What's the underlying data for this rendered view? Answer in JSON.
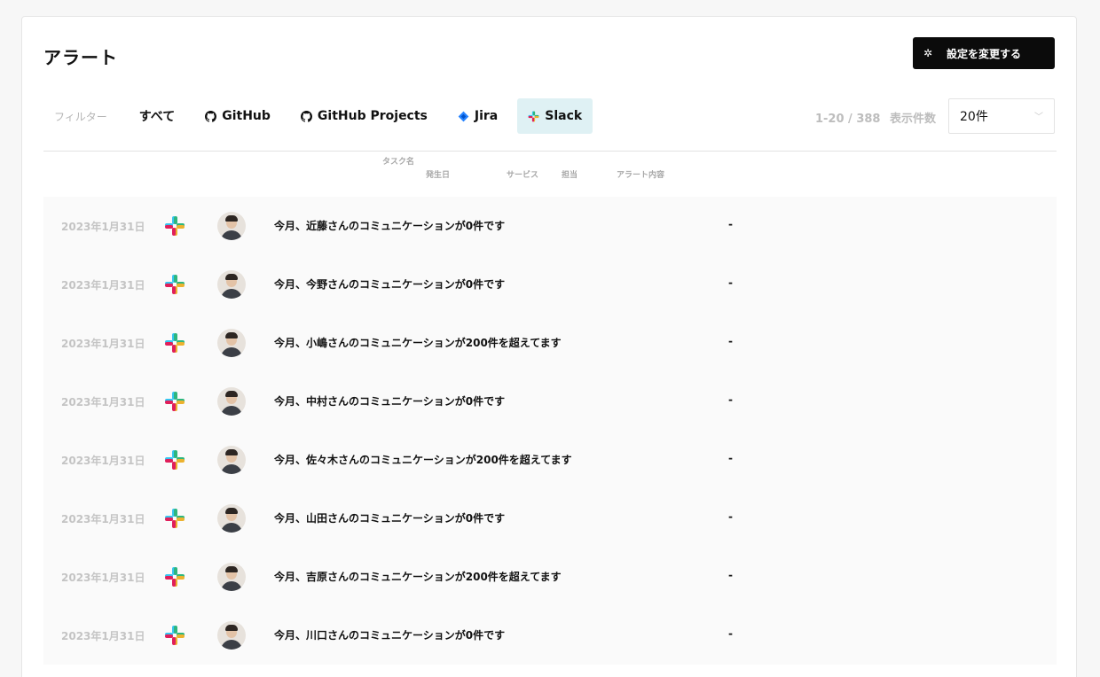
{
  "page": {
    "title": "アラート"
  },
  "toolbar": {
    "settings_label": "設定を変更する",
    "settings_icon": "gear-icon"
  },
  "filters": {
    "label": "フィルター",
    "tabs": [
      {
        "label": "すべて",
        "icon": ""
      },
      {
        "label": "GitHub",
        "icon": "github-icon"
      },
      {
        "label": "GitHub Projects",
        "icon": "github-icon"
      },
      {
        "label": "Jira",
        "icon": "jira-icon"
      },
      {
        "label": "Slack",
        "icon": "slack-icon",
        "active": true
      }
    ]
  },
  "pagination": {
    "range": "1-20 / 388",
    "per_page_label": "表示件数",
    "page_size": "20件"
  },
  "table": {
    "headers": {
      "task": "タスク名",
      "date": "発生日",
      "service": "サービス",
      "assignee": "担当",
      "content": "アラート内容"
    },
    "rows": [
      {
        "date": "2023年1月31日",
        "service": "slack-icon",
        "task": "今月、近藤さんのコミュニケーションが0件です",
        "content": "-"
      },
      {
        "date": "2023年1月31日",
        "service": "slack-icon",
        "task": "今月、今野さんのコミュニケーションが0件です",
        "content": "-"
      },
      {
        "date": "2023年1月31日",
        "service": "slack-icon",
        "task": "今月、小嶋さんのコミュニケーションが200件を超えてます",
        "content": "-"
      },
      {
        "date": "2023年1月31日",
        "service": "slack-icon",
        "task": "今月、中村さんのコミュニケーションが0件です",
        "content": "-"
      },
      {
        "date": "2023年1月31日",
        "service": "slack-icon",
        "task": "今月、佐々木さんのコミュニケーションが200件を超えてます",
        "content": "-"
      },
      {
        "date": "2023年1月31日",
        "service": "slack-icon",
        "task": "今月、山田さんのコミュニケーションが0件です",
        "content": "-"
      },
      {
        "date": "2023年1月31日",
        "service": "slack-icon",
        "task": "今月、吉原さんのコミュニケーションが200件を超えてます",
        "content": "-"
      },
      {
        "date": "2023年1月31日",
        "service": "slack-icon",
        "task": "今月、川口さんのコミュニケーションが0件です",
        "content": "-"
      }
    ]
  },
  "colors": {
    "slack_blue": "#36C5F0",
    "slack_green": "#2EB67D",
    "slack_yellow": "#ECB22E",
    "slack_red": "#E01E5A",
    "active_tab_bg": "#dff1f4",
    "jira_blue": "#2684FF"
  }
}
